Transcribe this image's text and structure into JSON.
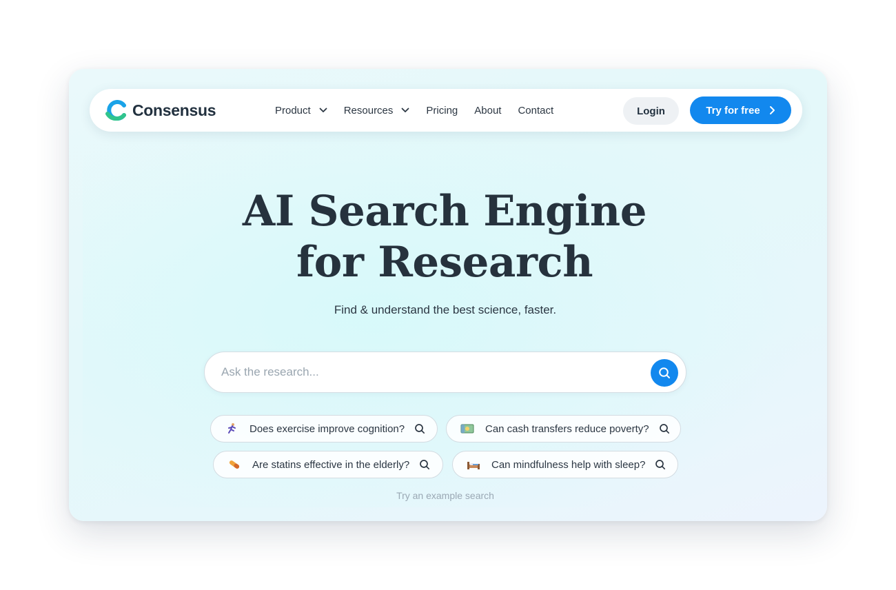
{
  "brand": {
    "name": "Consensus",
    "accent": "#1288ee",
    "logo_colors": [
      "#1aa3e8",
      "#30c48d"
    ]
  },
  "nav": {
    "items": [
      {
        "label": "Product",
        "has_dropdown": true
      },
      {
        "label": "Resources",
        "has_dropdown": true
      },
      {
        "label": "Pricing",
        "has_dropdown": false
      },
      {
        "label": "About",
        "has_dropdown": false
      },
      {
        "label": "Contact",
        "has_dropdown": false
      }
    ],
    "login_label": "Login",
    "cta_label": "Try for free"
  },
  "hero": {
    "title_line1": "AI Search Engine",
    "title_line2": "for Research",
    "subtitle": "Find & understand the best science, faster."
  },
  "search": {
    "placeholder": "Ask the research...",
    "value": ""
  },
  "examples": {
    "label": "Try an example search",
    "chips": [
      {
        "icon": "running-person-icon",
        "text": "Does exercise improve cognition?"
      },
      {
        "icon": "money-icon",
        "text": "Can cash transfers reduce poverty?"
      },
      {
        "icon": "pill-icon",
        "text": "Are statins effective in the elderly?"
      },
      {
        "icon": "bed-icon",
        "text": "Can mindfulness help with sleep?"
      }
    ]
  }
}
